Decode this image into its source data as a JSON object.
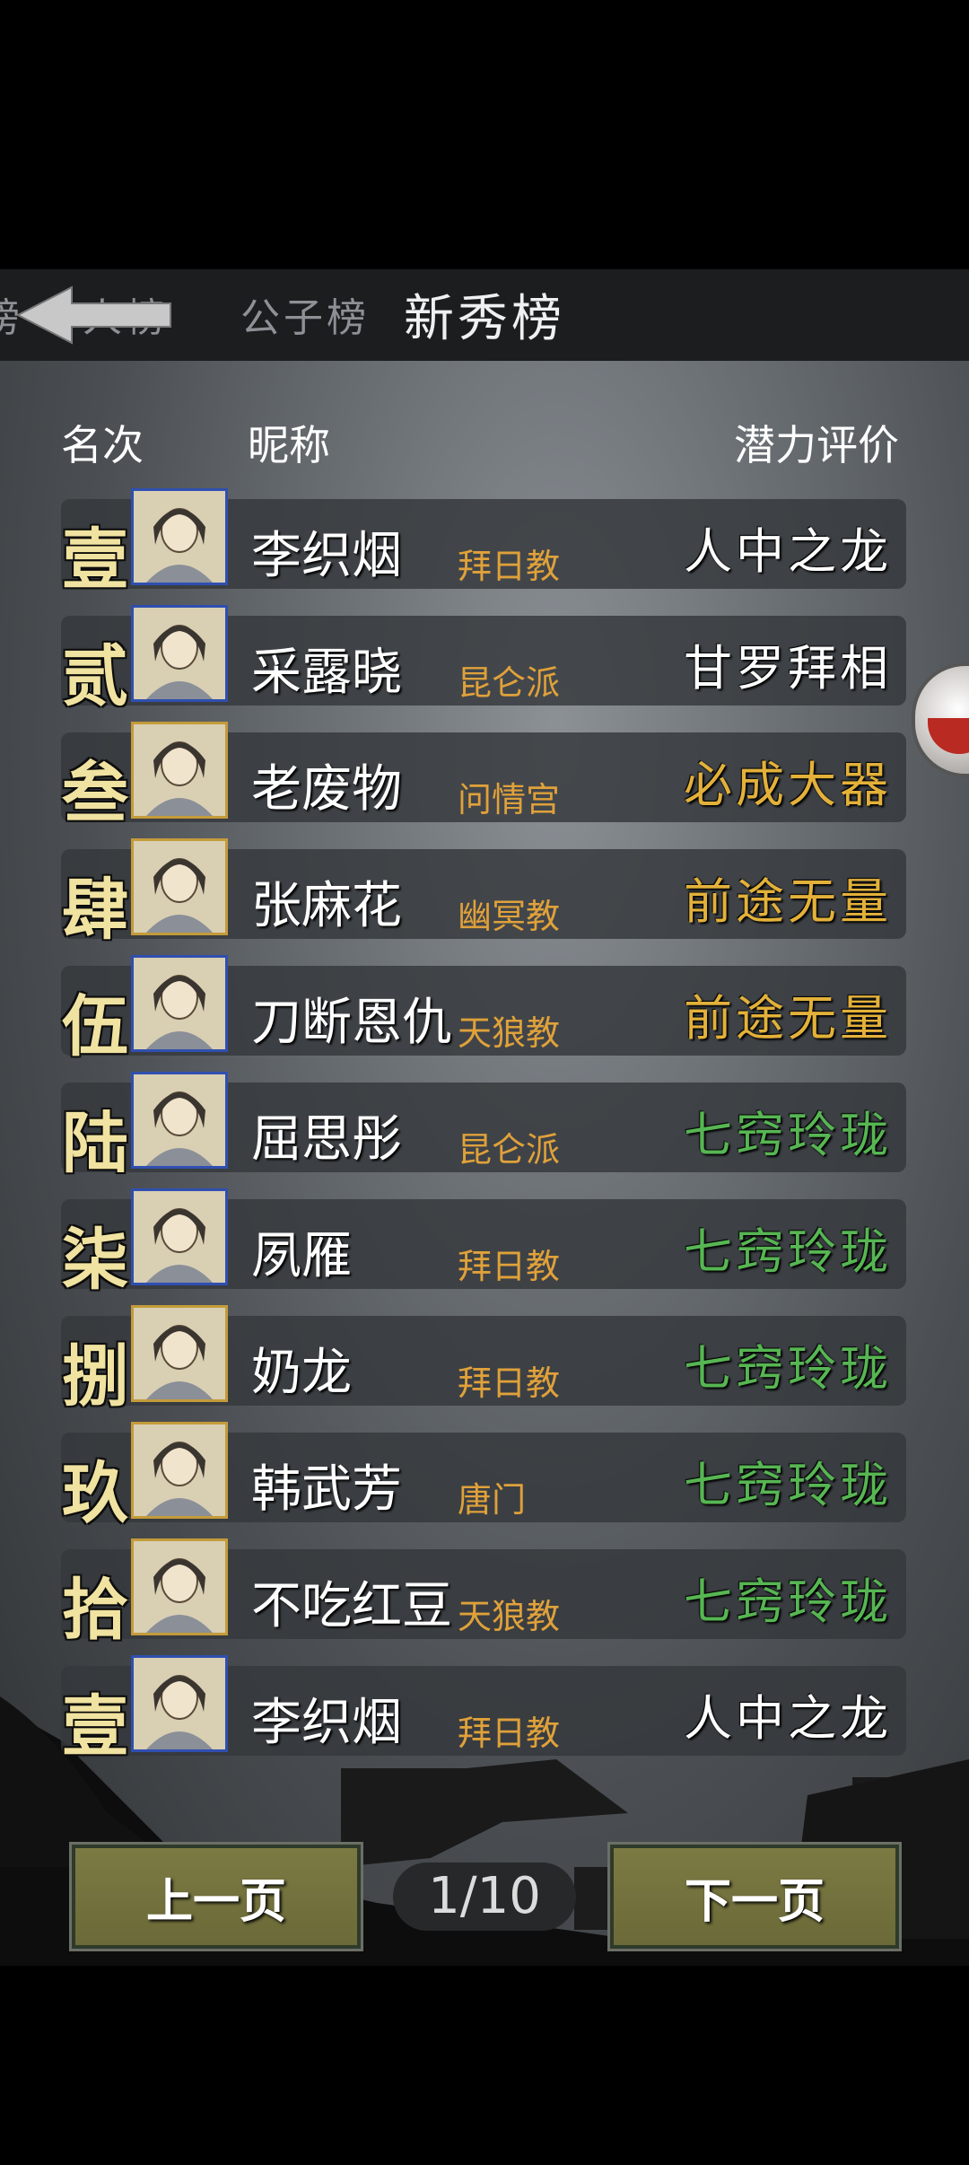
{
  "tabs": [
    "人榜",
    "公子榜",
    "新秀榜"
  ],
  "active_tab_index": 2,
  "tab_partial_left": "榜",
  "headers": {
    "rank": "名次",
    "nickname": "昵称",
    "potential": "潜力评价"
  },
  "colors": {
    "gold_eval": "#e3b13a",
    "white_eval": "#ffffff",
    "green_eval": "#57b653",
    "sect": "#e0a13a"
  },
  "rows": [
    {
      "rank": "壹",
      "name": "李织烟",
      "sect": "拜日教",
      "eval": "人中之龙",
      "tier": "white"
    },
    {
      "rank": "贰",
      "name": "采露晓",
      "sect": "昆仑派",
      "eval": "甘罗拜相",
      "tier": "white"
    },
    {
      "rank": "叁",
      "name": "老废物",
      "sect": "问情宫",
      "eval": "必成大器",
      "tier": "gold"
    },
    {
      "rank": "肆",
      "name": "张麻花",
      "sect": "幽冥教",
      "eval": "前途无量",
      "tier": "gold"
    },
    {
      "rank": "伍",
      "name": "刀断恩仇",
      "sect": "天狼教",
      "eval": "前途无量",
      "tier": "gold"
    },
    {
      "rank": "陆",
      "name": "屈思彤",
      "sect": "昆仑派",
      "eval": "七窍玲珑",
      "tier": "green"
    },
    {
      "rank": "柒",
      "name": "夙雁",
      "sect": "拜日教",
      "eval": "七窍玲珑",
      "tier": "green"
    },
    {
      "rank": "捌",
      "name": "奶龙",
      "sect": "拜日教",
      "eval": "七窍玲珑",
      "tier": "green"
    },
    {
      "rank": "玖",
      "name": "韩武芳",
      "sect": "唐门",
      "eval": "七窍玲珑",
      "tier": "green"
    },
    {
      "rank": "拾",
      "name": "不吃红豆",
      "sect": "天狼教",
      "eval": "七窍玲珑",
      "tier": "green"
    },
    {
      "rank": "壹",
      "name": "李织烟",
      "sect": "拜日教",
      "eval": "人中之龙",
      "tier": "white"
    }
  ],
  "pager": {
    "prev": "上一页",
    "next": "下一页",
    "indicator": "1/10"
  }
}
